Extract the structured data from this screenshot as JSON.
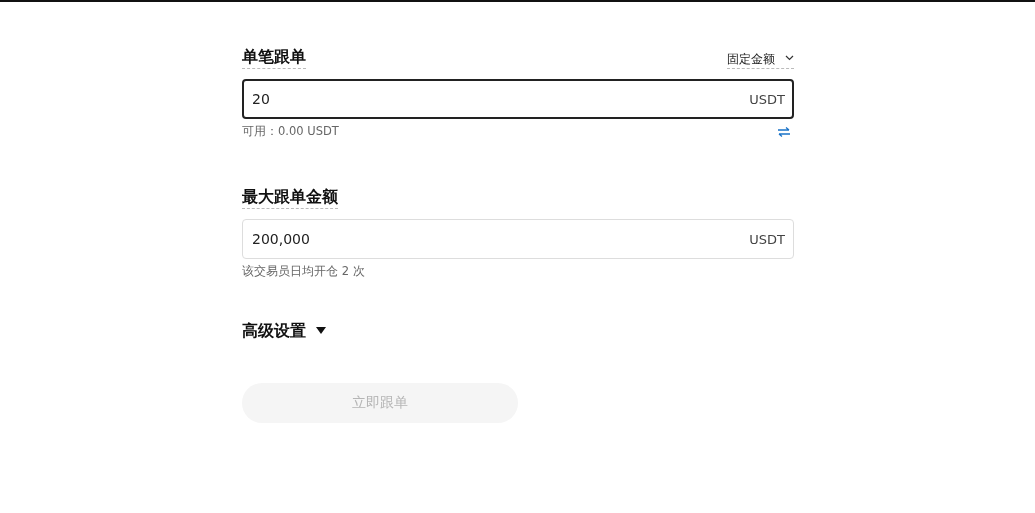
{
  "sections": [
    {
      "title": "单笔跟单",
      "mode_dropdown": {
        "label": "固定金额"
      },
      "field": {
        "value": "20",
        "unit": "USDT",
        "focused": true
      },
      "hint": "可用：0.00 USDT",
      "swap_icon": true
    },
    {
      "title": "最大跟单金额",
      "field": {
        "value": "200,000",
        "unit": "USDT",
        "focused": false
      },
      "hint": "该交易员日均开仓 2 次",
      "swap_icon": false
    }
  ],
  "advanced": {
    "label": "高级设置",
    "expanded": false
  },
  "submit_button": {
    "label": "立即跟单",
    "disabled": true
  }
}
